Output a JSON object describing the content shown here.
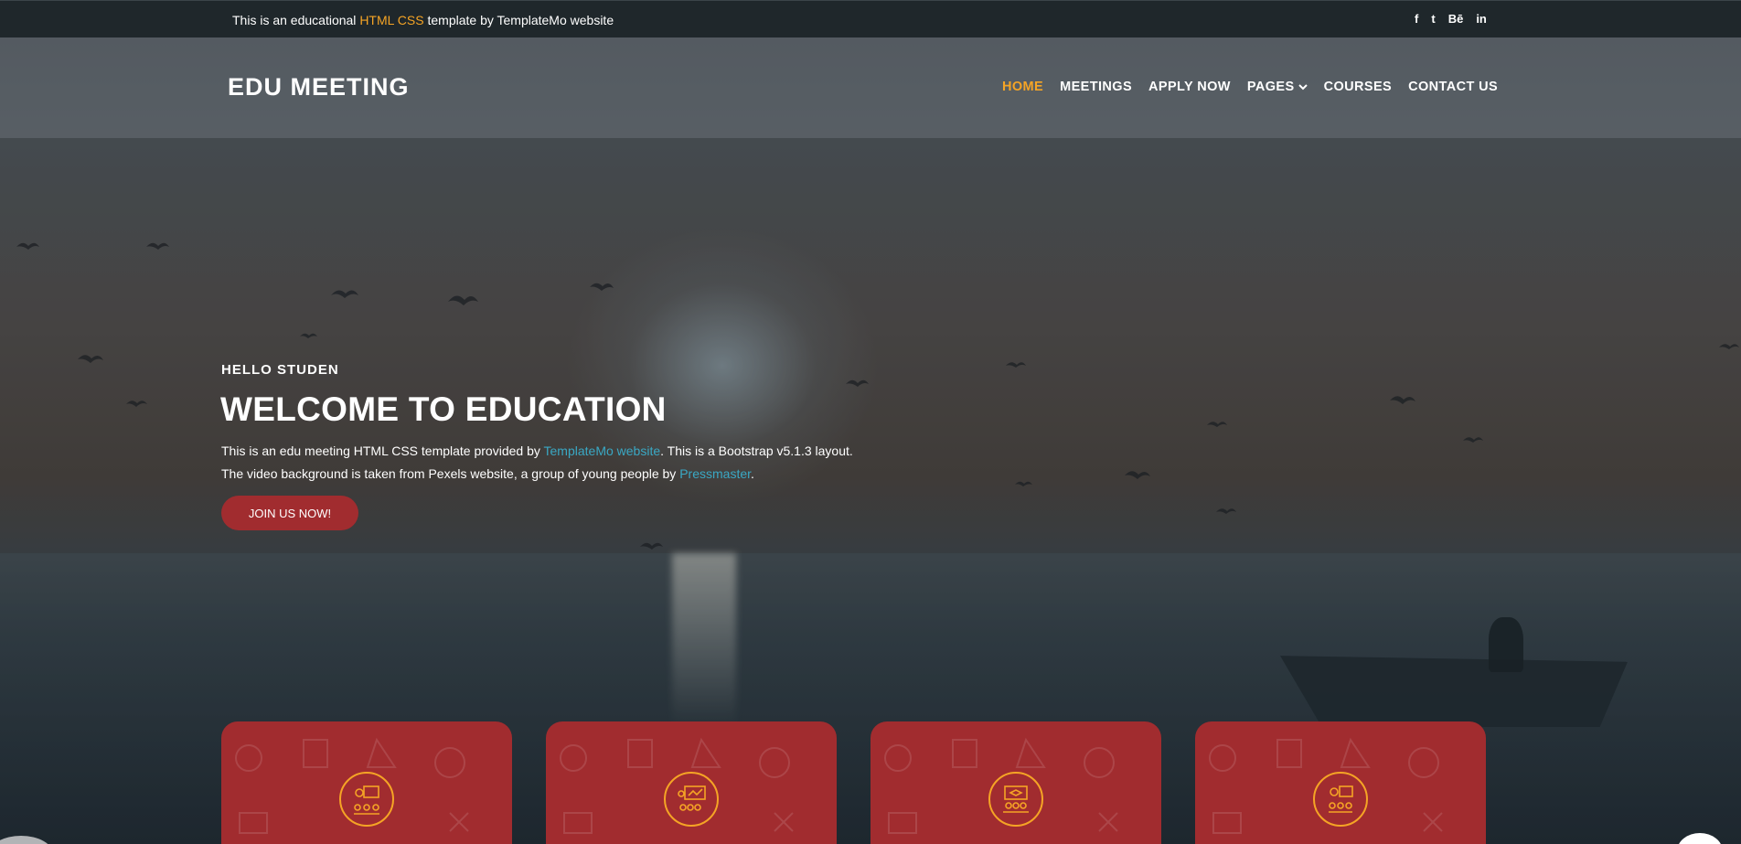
{
  "topbar": {
    "text_before": "This is an educational ",
    "text_highlight": "HTML CSS",
    "text_after": " template by TemplateMo website",
    "social": [
      "f",
      "t",
      "Bē",
      "in"
    ]
  },
  "header": {
    "logo": "EDU MEETING",
    "nav": [
      {
        "label": "HOME",
        "active": true
      },
      {
        "label": "MEETINGS"
      },
      {
        "label": "APPLY NOW"
      },
      {
        "label": "PAGES"
      },
      {
        "label": "COURSES"
      },
      {
        "label": "CONTACT US"
      }
    ]
  },
  "hero": {
    "kicker": "HELLO STUDEN",
    "title": "WELCOME TO EDUCATION",
    "line1_before": "This is an edu meeting HTML CSS template provided by ",
    "line1_link": "TemplateMo website",
    "line1_after": ". This is a Bootstrap v5.1.3 layout.",
    "line2_before": "The video background is taken from Pexels website, a group of young people by ",
    "line2_link": "Pressmaster",
    "line2_after": ".",
    "cta": "JOIN US NOW!"
  },
  "colors": {
    "accent": "#f5a425",
    "brand_red": "#a12c2f",
    "link": "#3aa8c4",
    "topbar_bg": "#1f272b"
  },
  "cards": [
    {
      "icon": "teacher-board-icon"
    },
    {
      "icon": "presentation-group-icon"
    },
    {
      "icon": "graduation-class-icon"
    },
    {
      "icon": "student-discussion-icon"
    }
  ]
}
